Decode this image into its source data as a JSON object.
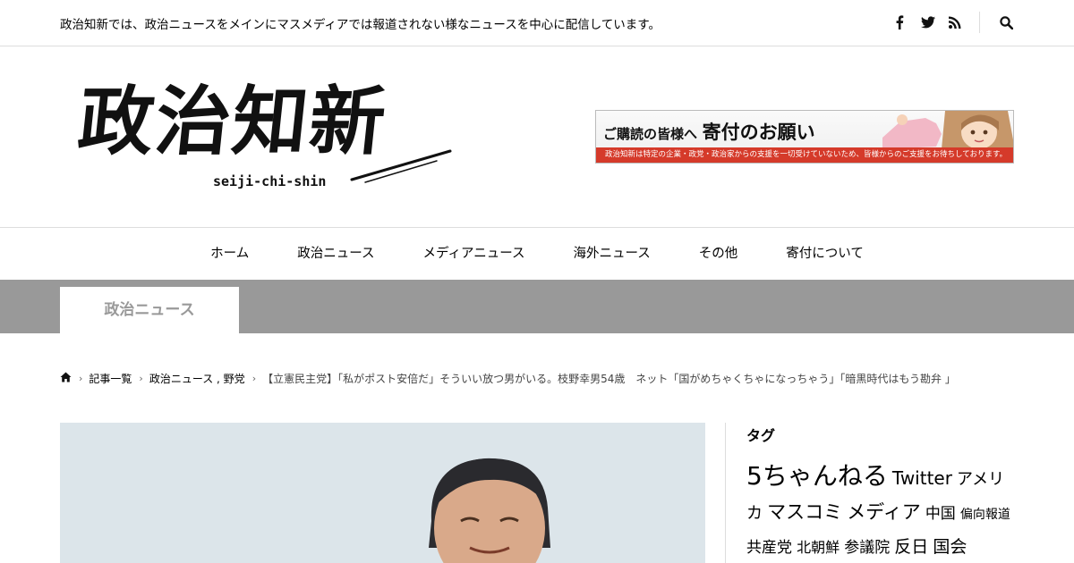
{
  "topbar": {
    "tagline": "政治知新では、政治ニュースをメインにマスメディアでは報道されない様なニュースを中心に配信しています。",
    "icons": [
      "facebook-icon",
      "twitter-icon",
      "rss-icon",
      "search-icon"
    ]
  },
  "header": {
    "logo_main": "政治知新",
    "logo_sub": "seiji-chi-shin",
    "banner": {
      "title_small": "ご購読の皆様へ",
      "title_big": "寄付のお願い",
      "strip": "政治知新は特定の企業・政党・政治家からの支援を一切受けていないため、皆様からのご支援をお待ちしております。"
    }
  },
  "nav": {
    "items": [
      "ホーム",
      "政治ニュース",
      "メディアニュース",
      "海外ニュース",
      "その他",
      "寄付について"
    ]
  },
  "category": {
    "label": "政治ニュース"
  },
  "breadcrumb": {
    "items": [
      "記事一覧",
      "政治ニュース , 野党",
      "【立憲民主党】「私がポスト安倍だ」そういい放つ男がいる。枝野幸男54歳　ネット「国がめちゃくちゃになっちゃう」「暗黒時代はもう勘弁 」"
    ]
  },
  "sidebar": {
    "title": "タグ",
    "tags": [
      {
        "text": "5ちゃんねる",
        "size": "large"
      },
      {
        "text": "Twitter",
        "size": "medium"
      },
      {
        "text": "アメリカ",
        "size": "medium-small"
      },
      {
        "text": "マスコミ",
        "size": "medium-large"
      },
      {
        "text": "メディア",
        "size": "medium-large"
      },
      {
        "text": "中国",
        "size": "medium-small"
      },
      {
        "text": "偏向報道",
        "size": "small"
      },
      {
        "text": "共産党",
        "size": "medium-small"
      },
      {
        "text": "北朝鮮",
        "size": "small-medium"
      },
      {
        "text": "参議院",
        "size": "medium-small"
      },
      {
        "text": "反日",
        "size": "medium"
      },
      {
        "text": "国会",
        "size": "medium"
      }
    ]
  },
  "colors": {
    "category_band": "#999999",
    "banner_strip": "#d53a2a"
  }
}
